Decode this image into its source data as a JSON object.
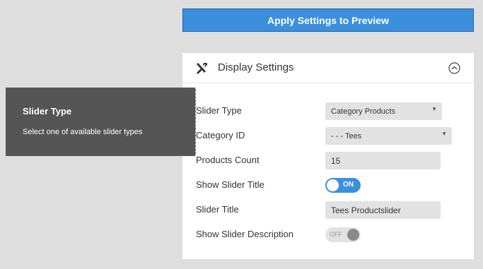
{
  "apply_button": {
    "label": "Apply Settings to Preview"
  },
  "panel": {
    "title": "Display Settings",
    "icon": "tools-icon",
    "collapse_icon": "chevron-up-circle-icon"
  },
  "fields": {
    "slider_type": {
      "label": "Slider Type",
      "value": "Category Products"
    },
    "category_id": {
      "label": "Category ID",
      "value": "- - - Tees"
    },
    "products_count": {
      "label": "Products Count",
      "value": "15"
    },
    "show_slider_title": {
      "label": "Show Slider Title",
      "state": "ON"
    },
    "slider_title": {
      "label": "Slider Title",
      "value": "Tees Productslider"
    },
    "show_slider_description": {
      "label": "Show Slider Description",
      "state": "OFF"
    }
  },
  "tooltip": {
    "title": "Slider Type",
    "text": "Select one of available slider types"
  },
  "colors": {
    "accent": "#3c8fdd",
    "tooltip_bg": "#555555",
    "page_bg": "#dedede"
  }
}
